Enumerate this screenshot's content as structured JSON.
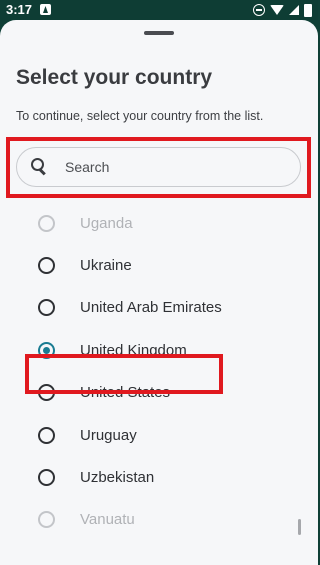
{
  "status_bar": {
    "time": "3:17",
    "icons": [
      "notification-icon",
      "dnd-icon",
      "wifi-icon",
      "signal-icon",
      "battery-icon"
    ]
  },
  "sheet": {
    "title": "Select your country",
    "subtitle": "To continue, select your country from the list.",
    "search": {
      "placeholder": "Search",
      "value": ""
    }
  },
  "countries": [
    {
      "name": "Uganda",
      "selected": false,
      "faded": true
    },
    {
      "name": "Ukraine",
      "selected": false,
      "faded": false
    },
    {
      "name": "United Arab Emirates",
      "selected": false,
      "faded": false
    },
    {
      "name": "United Kingdom",
      "selected": true,
      "faded": false
    },
    {
      "name": "United States",
      "selected": false,
      "faded": false
    },
    {
      "name": "Uruguay",
      "selected": false,
      "faded": false
    },
    {
      "name": "Uzbekistan",
      "selected": false,
      "faded": false
    },
    {
      "name": "Vanuatu",
      "selected": false,
      "faded": true
    }
  ],
  "colors": {
    "accent": "#1a7c92",
    "highlight_annotation": "#e0191f",
    "status_bar_bg": "#0e3d34"
  }
}
